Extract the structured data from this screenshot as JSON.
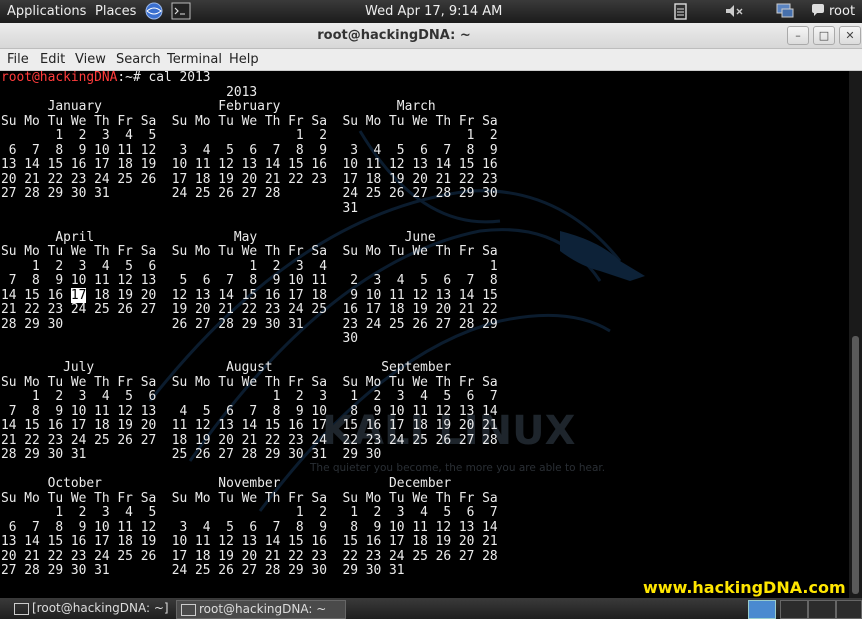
{
  "topbar": {
    "applications": "Applications",
    "places": "Places",
    "datetime": "Wed Apr 17,  9:14 AM",
    "user": "root"
  },
  "window": {
    "title": "root@hackingDNA: ~",
    "minimize": "–",
    "maximize": "□",
    "close": "✕"
  },
  "menu": [
    "File",
    "Edit",
    "View",
    "Search",
    "Terminal",
    "Help"
  ],
  "terminal": {
    "prompt_user": "root@hackingDNA",
    "prompt_rest": ":~# cal 2013",
    "calendar_before": "                             2013\n      January               February               March\nSu Mo Tu We Th Fr Sa  Su Mo Tu We Th Fr Sa  Su Mo Tu We Th Fr Sa\n       1  2  3  4  5                  1  2                  1  2\n 6  7  8  9 10 11 12   3  4  5  6  7  8  9   3  4  5  6  7  8  9\n13 14 15 16 17 18 19  10 11 12 13 14 15 16  10 11 12 13 14 15 16\n20 21 22 23 24 25 26  17 18 19 20 21 22 23  17 18 19 20 21 22 23\n27 28 29 30 31        24 25 26 27 28        24 25 26 27 28 29 30\n                                            31\n\n       April                  May                   June\nSu Mo Tu We Th Fr Sa  Su Mo Tu We Th Fr Sa  Su Mo Tu We Th Fr Sa\n    1  2  3  4  5  6            1  2  3  4                     1\n 7  8  9 10 11 12 13   5  6  7  8  9 10 11   2  3  4  5  6  7  8\n14 15 16 ",
    "today": "17",
    "calendar_after": " 18 19 20  12 13 14 15 16 17 18   9 10 11 12 13 14 15\n21 22 23 24 25 26 27  19 20 21 22 23 24 25  16 17 18 19 20 21 22\n28 29 30              26 27 28 29 30 31     23 24 25 26 27 28 29\n                                            30\n\n        July                 August              September\nSu Mo Tu We Th Fr Sa  Su Mo Tu We Th Fr Sa  Su Mo Tu We Th Fr Sa\n    1  2  3  4  5  6               1  2  3   1  2  3  4  5  6  7\n 7  8  9 10 11 12 13   4  5  6  7  8  9 10   8  9 10 11 12 13 14\n14 15 16 17 18 19 20  11 12 13 14 15 16 17  15 16 17 18 19 20 21\n21 22 23 24 25 26 27  18 19 20 21 22 23 24  22 23 24 25 26 27 28\n28 29 30 31           25 26 27 28 29 30 31  29 30\n\n      October               November              December\nSu Mo Tu We Th Fr Sa  Su Mo Tu We Th Fr Sa  Su Mo Tu We Th Fr Sa\n       1  2  3  4  5                  1  2   1  2  3  4  5  6  7\n 6  7  8  9 10 11 12   3  4  5  6  7  8  9   8  9 10 11 12 13 14\n13 14 15 16 17 18 19  10 11 12 13 14 15 16  15 16 17 18 19 20 21\n20 21 22 23 24 25 26  17 18 19 20 21 22 23  22 23 24 25 26 27 28\n27 28 29 30 31        24 25 26 27 28 29 30  29 30 31"
  },
  "background": {
    "logo_text": "KALI LINUX",
    "tagline": "The quieter you become, the more you are able to hear."
  },
  "watermark": "www.hackingDNA.com",
  "taskbar": {
    "task1": "[root@hackingDNA: ~]",
    "task2": "root@hackingDNA: ~"
  },
  "colors": {
    "prompt_user": "#ff3b3b",
    "watermark": "#ffe600",
    "terminal_bg": "#000000",
    "terminal_fg": "#ececec"
  }
}
